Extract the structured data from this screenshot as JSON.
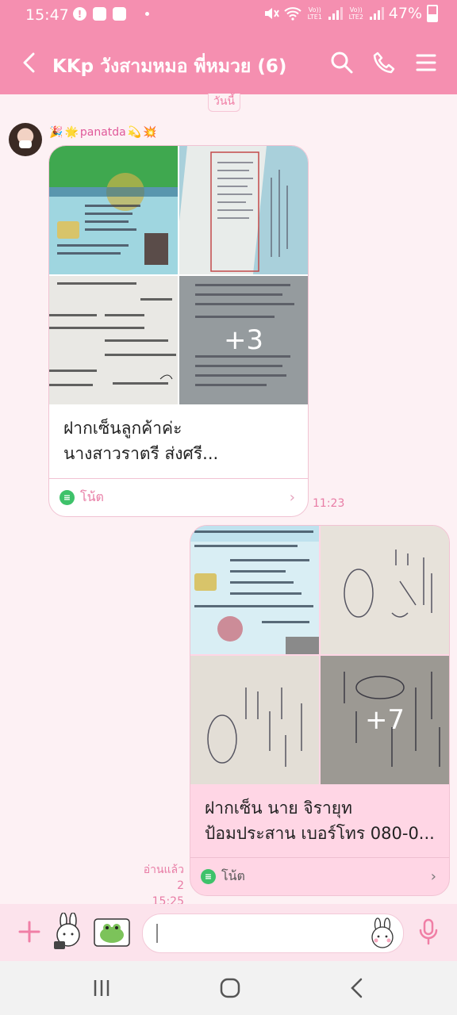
{
  "status_bar": {
    "time": "15:47",
    "sim1": "Vo)) LTE1",
    "sim2": "Vo)) LTE2",
    "battery": "47%"
  },
  "header": {
    "title": "KKp วังสามหมอ พี่หมวย (6)"
  },
  "date_chip": "วันนี้",
  "incoming": {
    "sender": "panatda",
    "more_count": "+3",
    "caption_line1": "ฝากเซ็นลูกค้าค่ะ",
    "caption_line2": "นางสาวราตรี ส่งศรี...",
    "note_label": "โน้ต",
    "time": "11:23"
  },
  "outgoing": {
    "more_count": "+7",
    "caption_line1": "ฝากเซ็น นาย จิรายุท",
    "caption_line2": "ป้อมประสาน เบอร์โทร 080-0...",
    "note_label": "โน้ต",
    "read_status": "อ่านแล้ว 2",
    "time": "15:25"
  },
  "input": {
    "placeholder": ""
  },
  "colors": {
    "accent": "#f58fb0",
    "bubble_out": "#ffd6e5",
    "note_green": "#3ec26a"
  }
}
